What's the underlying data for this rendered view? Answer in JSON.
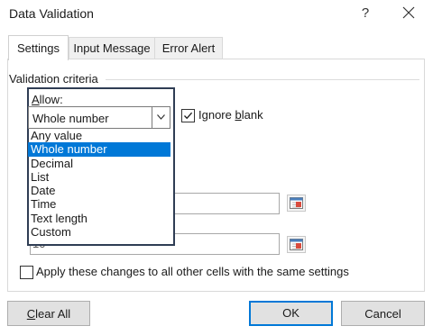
{
  "window": {
    "title": "Data Validation",
    "help_label": "?"
  },
  "tabs": [
    {
      "label": "Settings",
      "active": true
    },
    {
      "label": "Input Message",
      "active": false
    },
    {
      "label": "Error Alert",
      "active": false
    }
  ],
  "settings": {
    "group_label": "Validation criteria",
    "allow_label_underline": "A",
    "allow_label_rest": "llow:",
    "allow_selected": "Whole number",
    "allow_options": [
      "Any value",
      "Whole number",
      "Decimal",
      "List",
      "Date",
      "Time",
      "Text length",
      "Custom"
    ],
    "selected_index": 1,
    "ignore_blank_checked": true,
    "ignore_blank_prefix": "Ignore ",
    "ignore_blank_underline": "b",
    "ignore_blank_rest": "lank",
    "maximum_value": "10",
    "apply_all_label": "Apply these changes to all other cells with the same settings",
    "apply_all_checked": false
  },
  "buttons": {
    "clear_all_underline": "C",
    "clear_all_rest": "lear All",
    "ok": "OK",
    "cancel": "Cancel"
  },
  "colors": {
    "selection": "#0078d7",
    "dropdown_border": "#2f3d54"
  }
}
